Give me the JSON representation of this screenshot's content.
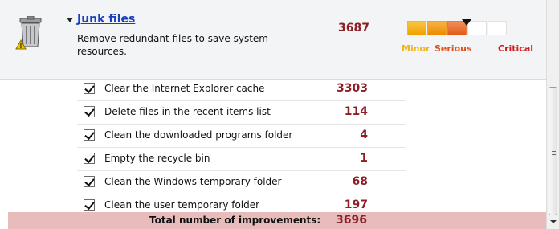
{
  "category": {
    "title": "Junk files",
    "description": "Remove redundant files to save system resources.",
    "count": "3687",
    "icon": "trash-warning-icon"
  },
  "severity": {
    "labels": {
      "minor": "Minor",
      "serious": "Serious",
      "critical": "Critical"
    },
    "level_fraction": 0.58,
    "colors": {
      "minor": "#f2b61a",
      "serious": "#e0521c",
      "critical": "#d61a1a"
    }
  },
  "items": [
    {
      "label": "Clear the Internet Explorer cache",
      "count": "3303",
      "checked": true
    },
    {
      "label": "Delete files in the recent items list",
      "count": "114",
      "checked": true
    },
    {
      "label": "Clean the downloaded programs folder",
      "count": "4",
      "checked": true
    },
    {
      "label": "Empty the recycle bin",
      "count": "1",
      "checked": true
    },
    {
      "label": "Clean the Windows temporary folder",
      "count": "68",
      "checked": true
    },
    {
      "label": "Clean the user temporary folder",
      "count": "197",
      "checked": true
    }
  ],
  "total": {
    "label": "Total number of improvements:",
    "count": "3696"
  }
}
